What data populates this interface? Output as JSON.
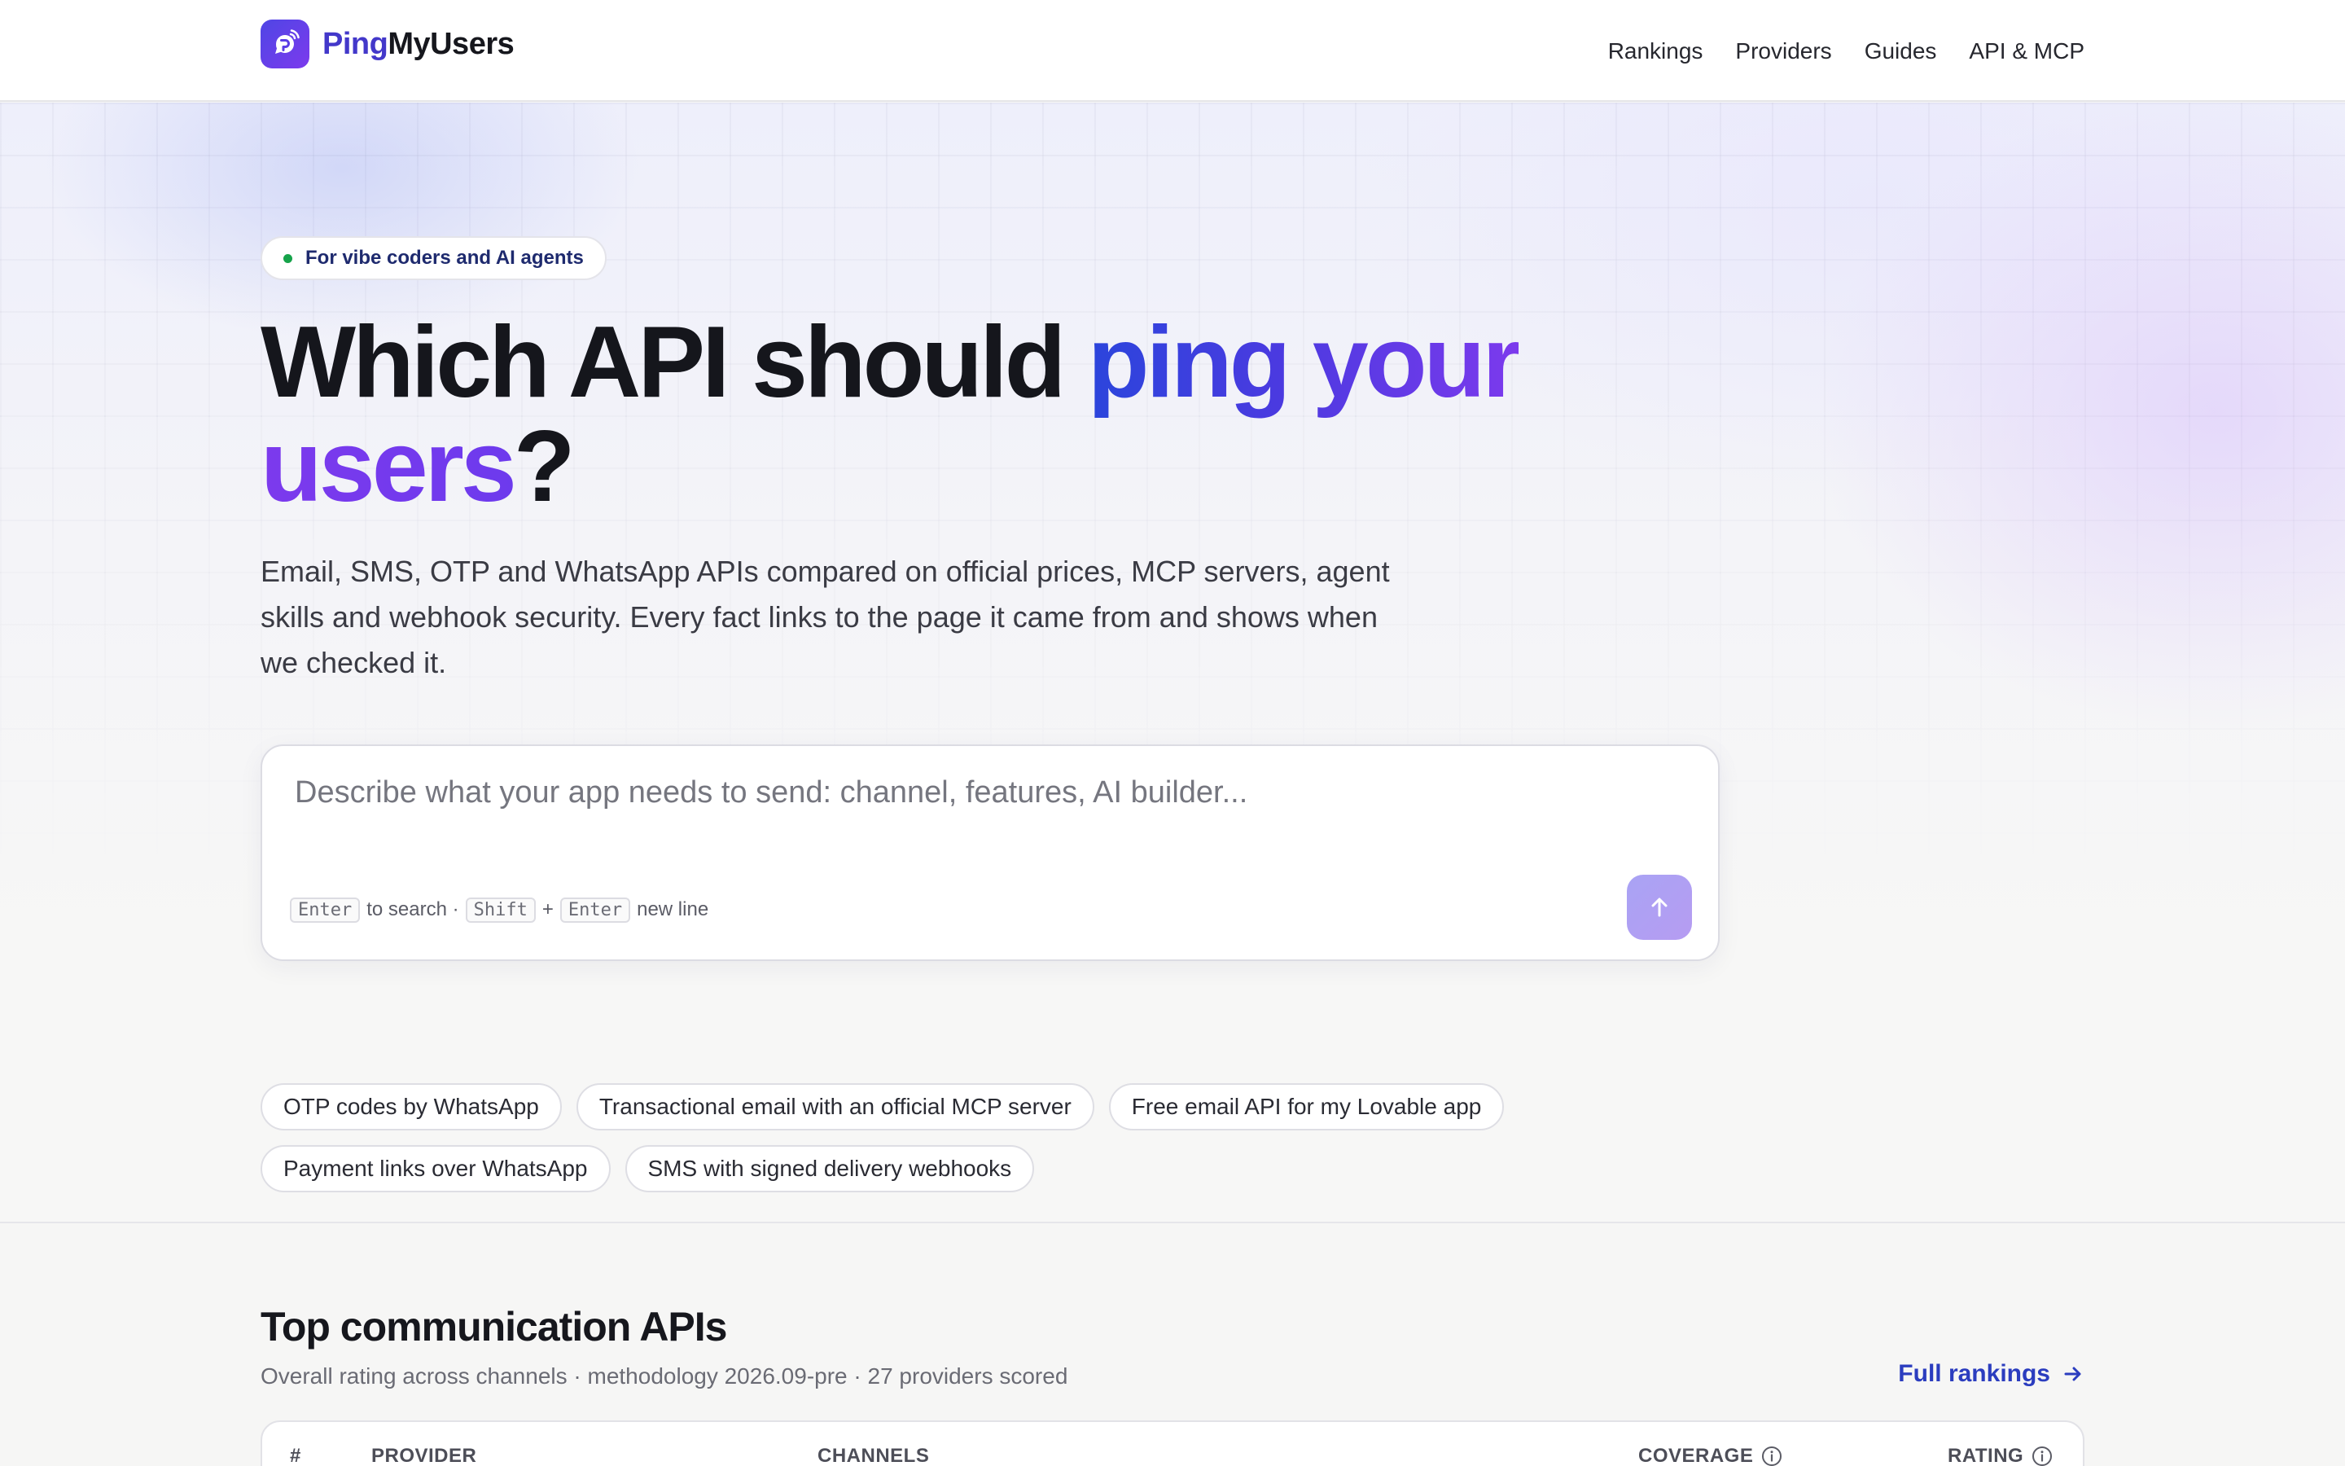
{
  "brand": {
    "name_part1": "Ping",
    "name_part2": "MyUsers",
    "logo_icon": "speech-bubble-signal-icon",
    "accent": "#4338ca",
    "accent_secondary": "#7c3aed"
  },
  "nav": {
    "items": [
      {
        "label": "Rankings"
      },
      {
        "label": "Providers"
      },
      {
        "label": "Guides"
      },
      {
        "label": "API & MCP"
      }
    ]
  },
  "hero": {
    "badge": "For vibe coders and AI agents",
    "headline_plain_1": "Which API should ",
    "headline_accent_1": "ping your",
    "headline_accent_2": "users",
    "headline_plain_2": "?",
    "subtext": "Email, SMS, OTP and WhatsApp APIs compared on official prices, MCP servers, agent skills and webhook security. Every fact links to the page it came from and shows when we checked it."
  },
  "search": {
    "value": "",
    "placeholder": "Describe what your app needs to send: channel, features, AI builder...",
    "hint_key_1": "Enter",
    "hint_text_1": "to search ·",
    "hint_key_2": "Shift",
    "hint_plus": "+",
    "hint_key_3": "Enter",
    "hint_text_2": "new line",
    "submit_icon": "arrow-up-icon"
  },
  "suggestions": [
    {
      "label": "OTP codes by WhatsApp"
    },
    {
      "label": "Transactional email with an official MCP server"
    },
    {
      "label": "Free email API for my Lovable app"
    },
    {
      "label": "Payment links over WhatsApp"
    },
    {
      "label": "SMS with signed delivery webhooks"
    }
  ],
  "rankings": {
    "title": "Top communication APIs",
    "subtitle": "Overall rating across channels · methodology 2026.09-pre · 27 providers scored",
    "full_link": "Full rankings",
    "columns": {
      "rank": "#",
      "provider": "PROVIDER",
      "channels": "CHANNELS",
      "coverage": "COVERAGE",
      "rating": "RATING"
    }
  }
}
